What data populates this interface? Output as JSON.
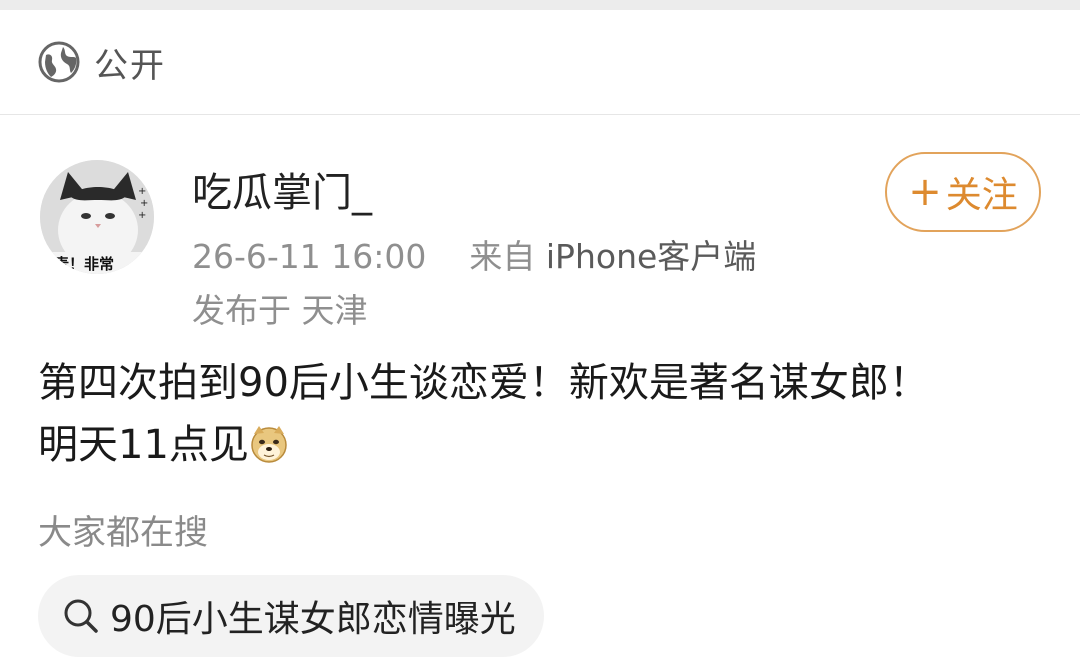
{
  "header": {
    "visibility_icon": "globe-icon",
    "visibility_label": "公开"
  },
  "post": {
    "author": {
      "name": "吃瓜掌门_",
      "avatar": "cat-avatar",
      "avatar_caption": "麦！非常"
    },
    "timestamp": "26-6-11 16:00",
    "source_prefix": "来自",
    "source_device": "iPhone客户端",
    "location": "发布于 天津",
    "follow_label": "关注",
    "text_line1": "第四次拍到90后小生谈恋爱！新欢是著名谋女郎！",
    "text_line2": "明天11点见",
    "emoji": "doge-emoji"
  },
  "trending": {
    "title": "大家都在搜",
    "search_icon": "search-icon",
    "query": "90后小生谋女郎恋情曝光"
  },
  "colors": {
    "follow_accent": "#dd8a2f",
    "follow_border": "#e2a35b",
    "muted_text": "#8f8f8f",
    "pill_background": "#f3f3f3"
  }
}
